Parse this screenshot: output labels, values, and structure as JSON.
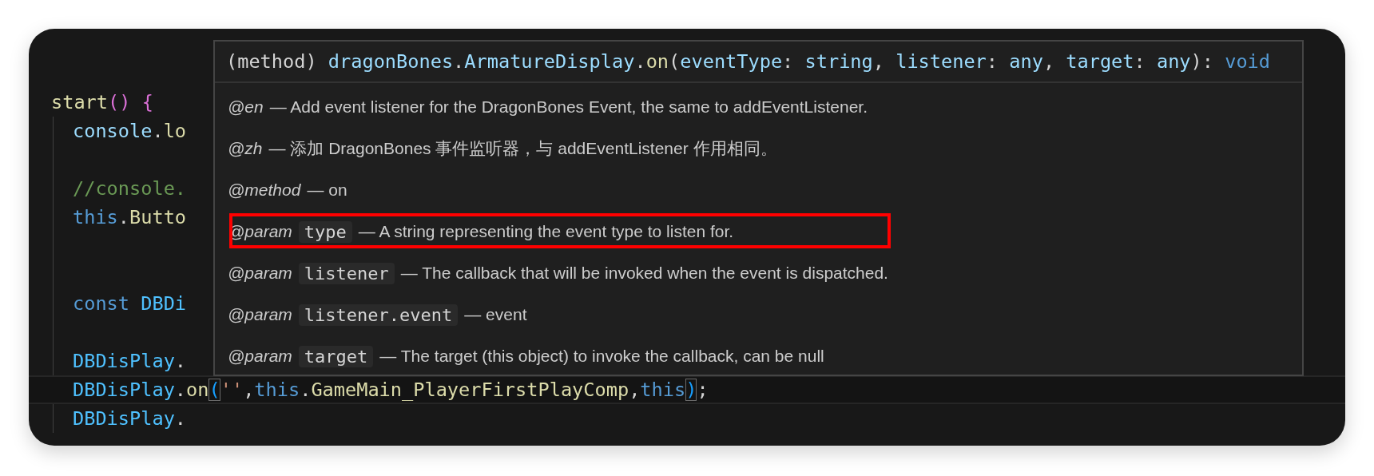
{
  "code_lines": [
    {
      "kind": "code",
      "current": false,
      "tokens": [
        {
          "kind": "fn",
          "text": "start"
        },
        {
          "kind": "paren",
          "text": "() {"
        }
      ],
      "children": [
        {
          "kind": "code",
          "current": false,
          "tokens": [
            {
              "kind": "var",
              "text": "console"
            },
            {
              "kind": "plain",
              "text": "."
            },
            {
              "kind": "fn",
              "text": "lo"
            }
          ]
        },
        {
          "kind": "blank"
        },
        {
          "kind": "code",
          "current": false,
          "tokens": [
            {
              "kind": "comment",
              "text": "//console."
            }
          ]
        },
        {
          "kind": "code",
          "current": false,
          "tokens": [
            {
              "kind": "keyword",
              "text": "this"
            },
            {
              "kind": "plain",
              "text": "."
            },
            {
              "kind": "fn",
              "text": "Butto"
            }
          ]
        },
        {
          "kind": "blank"
        },
        {
          "kind": "blank"
        },
        {
          "kind": "code",
          "current": false,
          "tokens": [
            {
              "kind": "keyword",
              "text": "const "
            },
            {
              "kind": "const",
              "text": "DBDi"
            }
          ]
        },
        {
          "kind": "blank"
        },
        {
          "kind": "code",
          "current": false,
          "tokens": [
            {
              "kind": "const",
              "text": "DBDisPlay"
            },
            {
              "kind": "plain",
              "text": "."
            }
          ]
        },
        {
          "kind": "code",
          "current": true,
          "tokens": [
            {
              "kind": "const",
              "text": "DBDisPlay"
            },
            {
              "kind": "plain",
              "text": "."
            },
            {
              "kind": "fn",
              "text": "on"
            },
            {
              "kind": "bracket",
              "text": "("
            },
            {
              "kind": "string",
              "text": "''"
            },
            {
              "kind": "plain",
              "text": ","
            },
            {
              "kind": "keyword",
              "text": "this"
            },
            {
              "kind": "plain",
              "text": "."
            },
            {
              "kind": "fn",
              "text": "GameMain_PlayerFirstPlayComp"
            },
            {
              "kind": "plain",
              "text": ","
            },
            {
              "kind": "keyword",
              "text": "this"
            },
            {
              "kind": "bracket",
              "text": ")"
            },
            {
              "kind": "plain",
              "text": ";"
            }
          ]
        },
        {
          "kind": "code",
          "current": false,
          "tokens": [
            {
              "kind": "const",
              "text": "DBDisPlay"
            },
            {
              "kind": "plain",
              "text": "."
            }
          ]
        }
      ]
    }
  ],
  "hover": {
    "signature": [
      {
        "kind": "plain",
        "text": "(method) "
      },
      {
        "kind": "var",
        "text": "dragonBones"
      },
      {
        "kind": "plain",
        "text": "."
      },
      {
        "kind": "var",
        "text": "ArmatureDisplay"
      },
      {
        "kind": "plain",
        "text": "."
      },
      {
        "kind": "fn",
        "text": "on"
      },
      {
        "kind": "plain",
        "text": "("
      },
      {
        "kind": "var",
        "text": "eventType"
      },
      {
        "kind": "plain",
        "text": ": "
      },
      {
        "kind": "var",
        "text": "string"
      },
      {
        "kind": "plain",
        "text": ", "
      },
      {
        "kind": "var",
        "text": "listener"
      },
      {
        "kind": "plain",
        "text": ": "
      },
      {
        "kind": "var",
        "text": "any"
      },
      {
        "kind": "plain",
        "text": ", "
      },
      {
        "kind": "var",
        "text": "target"
      },
      {
        "kind": "plain",
        "text": ": "
      },
      {
        "kind": "var",
        "text": "any"
      },
      {
        "kind": "plain",
        "text": "): "
      },
      {
        "kind": "keyword",
        "text": "void"
      }
    ],
    "docs": [
      {
        "tag": "@en",
        "text": "— Add event listener for the DragonBones Event, the same to addEventListener.",
        "highlighted": false
      },
      {
        "tag": "@zh",
        "text": "— 添加 DragonBones 事件监听器，与 addEventListener 作用相同。",
        "highlighted": false
      },
      {
        "tag": "@method",
        "text": "— on",
        "highlighted": false
      },
      {
        "tag": "@param",
        "param": "type",
        "text": "— A string representing the event type to listen for.",
        "highlighted": true
      },
      {
        "tag": "@param",
        "param": "listener",
        "text": "— The callback that will be invoked when the event is dispatched.",
        "highlighted": false
      },
      {
        "tag": "@param",
        "param": "listener.event",
        "text": "— event",
        "highlighted": false
      },
      {
        "tag": "@param",
        "param": "target",
        "text": "— The target (this object) to invoke the callback, can be null",
        "highlighted": false
      }
    ]
  }
}
